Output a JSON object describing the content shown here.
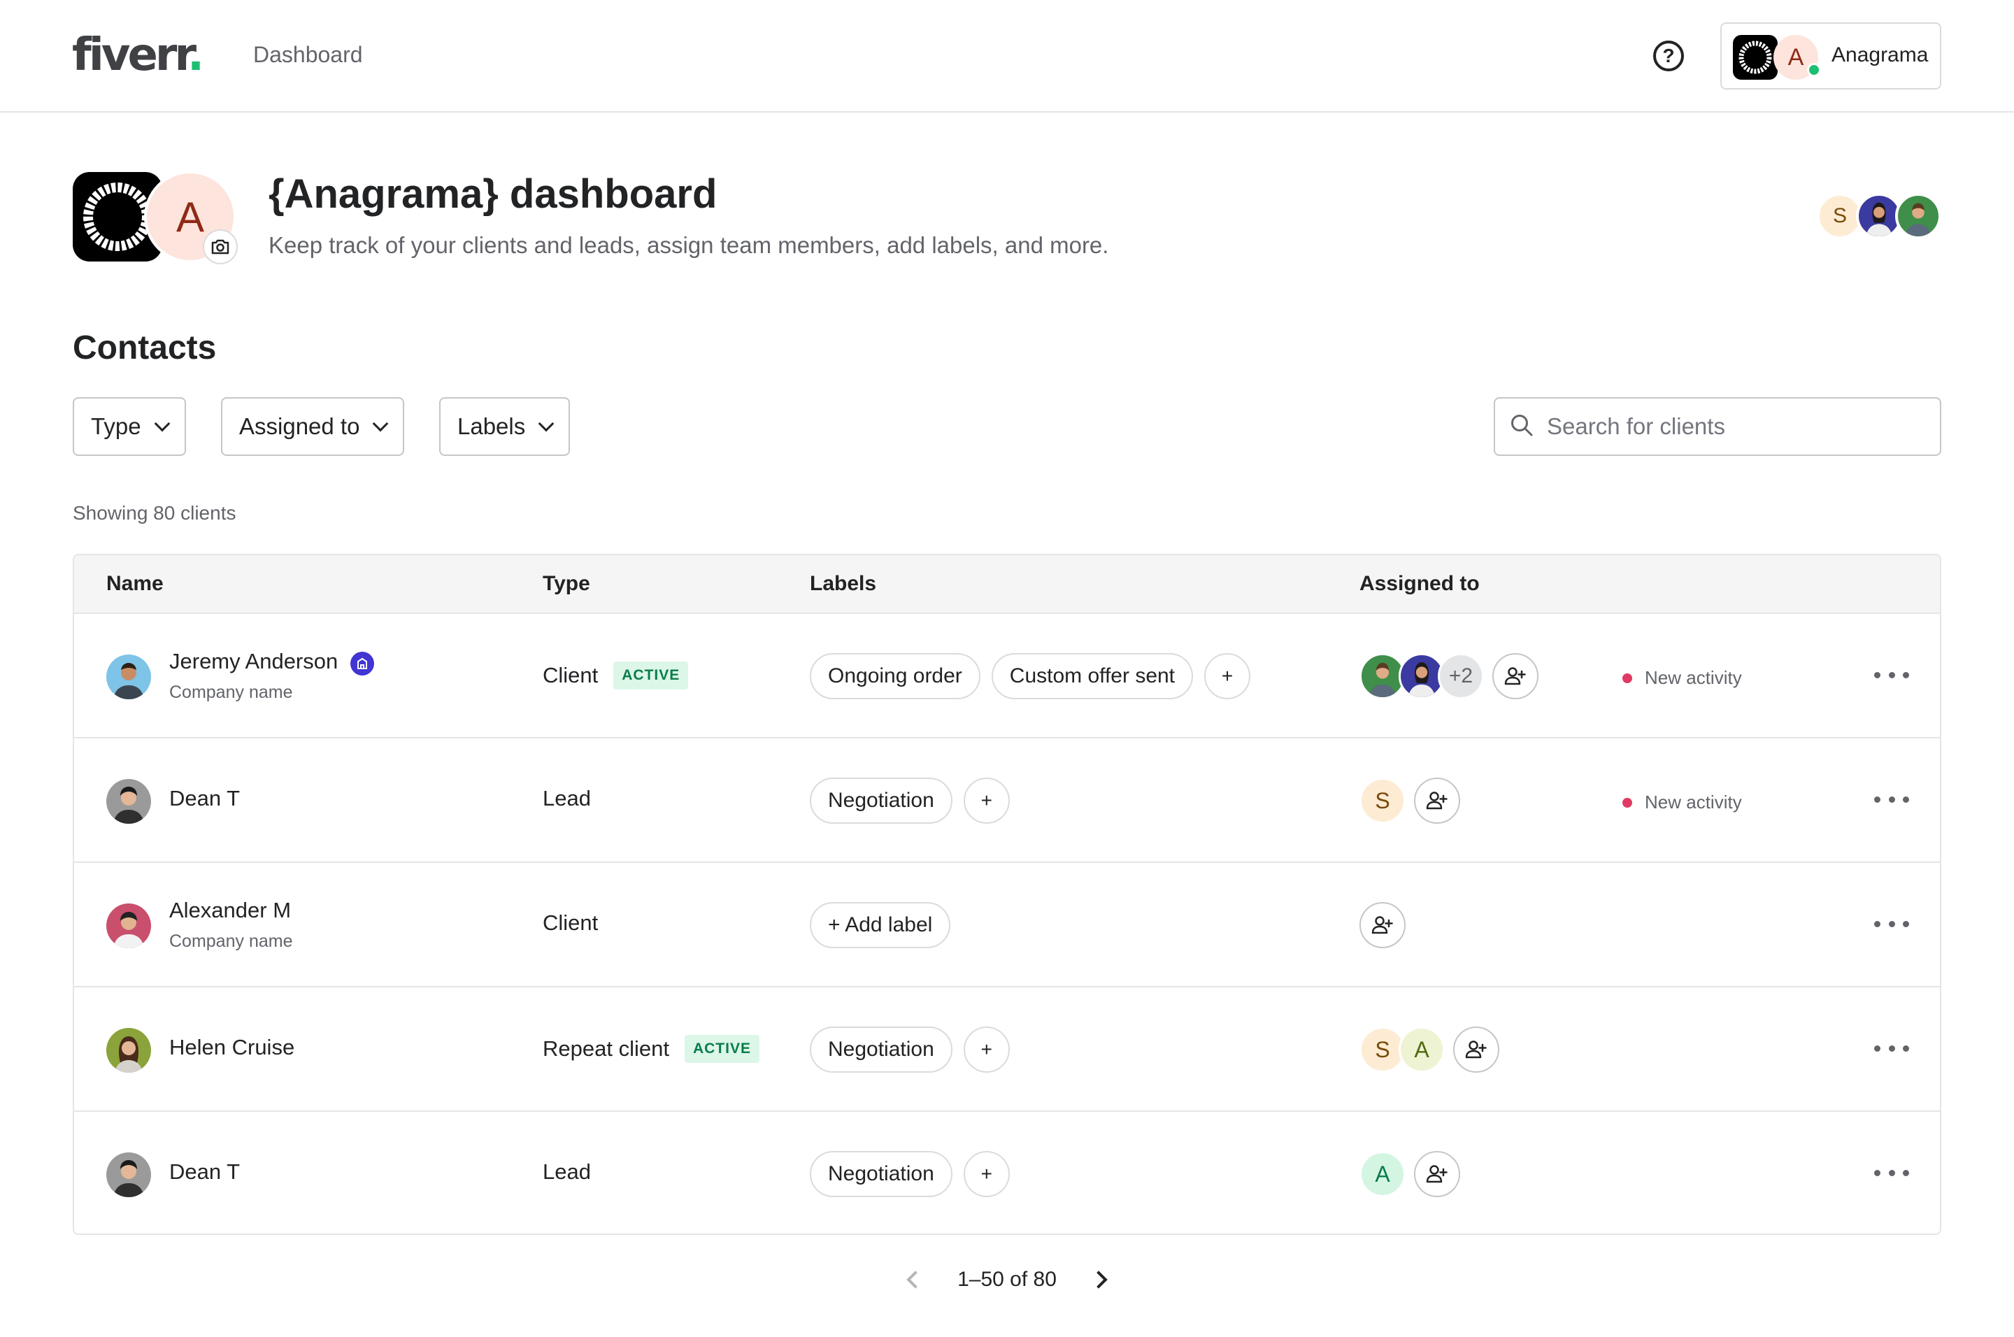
{
  "topbar": {
    "logo": "fiverr",
    "logo_dot": ".",
    "nav_dashboard": "Dashboard",
    "help_icon": "question-mark-circle-icon",
    "help_glyph": "?",
    "account_initial": "A",
    "account_name": "Anagrama"
  },
  "header": {
    "avatar_initial": "A",
    "title": "{Anagrama} dashboard",
    "subtitle": "Keep track of your clients and leads, assign team members, add labels, and more.",
    "team_initial": "S"
  },
  "contacts": {
    "title": "Contacts",
    "filters": [
      "Type",
      "Assigned to",
      "Labels"
    ],
    "search_placeholder": "Search for clients",
    "showing": "Showing 80 clients",
    "columns": [
      "Name",
      "Type",
      "Labels",
      "Assigned to"
    ],
    "rows": [
      {
        "name": "Jeremy Anderson",
        "company": "Company name",
        "type": "Client",
        "badge": "ACTIVE",
        "labels": [
          "Ongoing order",
          "Custom offer sent"
        ],
        "add_label": "+",
        "assigned_more": "+2",
        "activity": "New activity"
      },
      {
        "name": "Dean T",
        "type": "Lead",
        "labels": [
          "Negotiation"
        ],
        "add_label": "+",
        "assigned_initials": [
          "S"
        ],
        "activity": "New activity"
      },
      {
        "name": "Alexander M",
        "company": "Company name",
        "type": "Client",
        "add_label_chip": "+ Add label"
      },
      {
        "name": "Helen Cruise",
        "type": "Repeat client",
        "badge": "ACTIVE",
        "labels": [
          "Negotiation"
        ],
        "add_label": "+",
        "assigned_initials": [
          "S",
          "A"
        ]
      },
      {
        "name": "Dean T",
        "type": "Lead",
        "labels": [
          "Negotiation"
        ],
        "add_label": "+",
        "assigned_initials": [
          "A"
        ]
      }
    ],
    "pagination": "1–50 of 80"
  },
  "colors": {
    "brand_green": "#1dbf73",
    "active_badge_bg": "#dcf6e8",
    "active_badge_text": "#0a7d49",
    "activity_dot": "#e03a63",
    "verified_badge": "#4135d3"
  }
}
